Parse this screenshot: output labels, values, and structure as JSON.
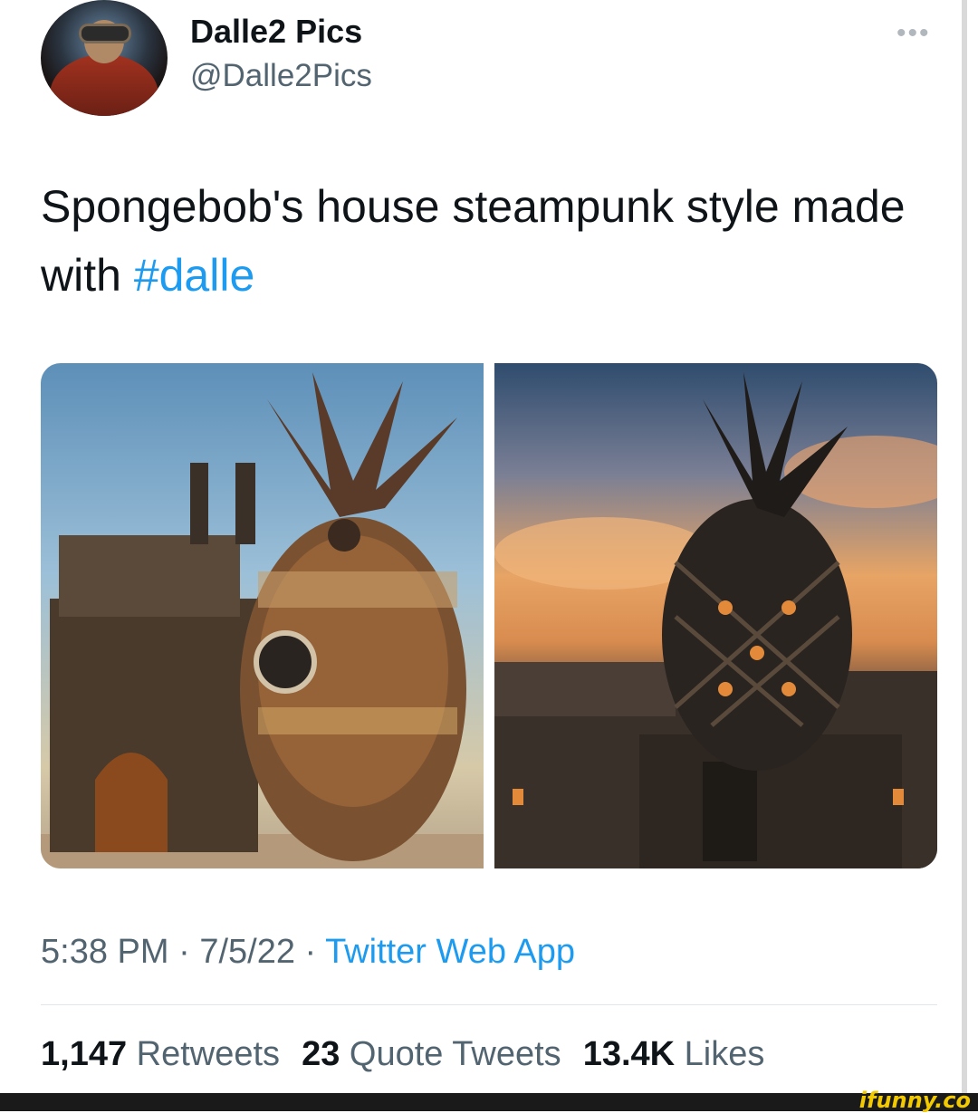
{
  "tweet": {
    "author_name": "Dalle2 Pics",
    "author_handle": "@Dalle2Pics",
    "more_label": "•••",
    "text_main": "Spongebob's house steampunk style made with ",
    "hashtag": "#dalle",
    "time": "5:38 PM",
    "date": "7/5/22",
    "separator": " · ",
    "source": "Twitter Web App",
    "retweets_count": "1,147",
    "retweets_label": "Retweets",
    "quotes_count": "23",
    "quotes_label": "Quote Tweets",
    "likes_count": "13.4K",
    "likes_label": "Likes"
  },
  "footer": {
    "watermark": "ifunny.co"
  },
  "colors": {
    "link": "#1d9bf0",
    "secondary_text": "#536471"
  }
}
